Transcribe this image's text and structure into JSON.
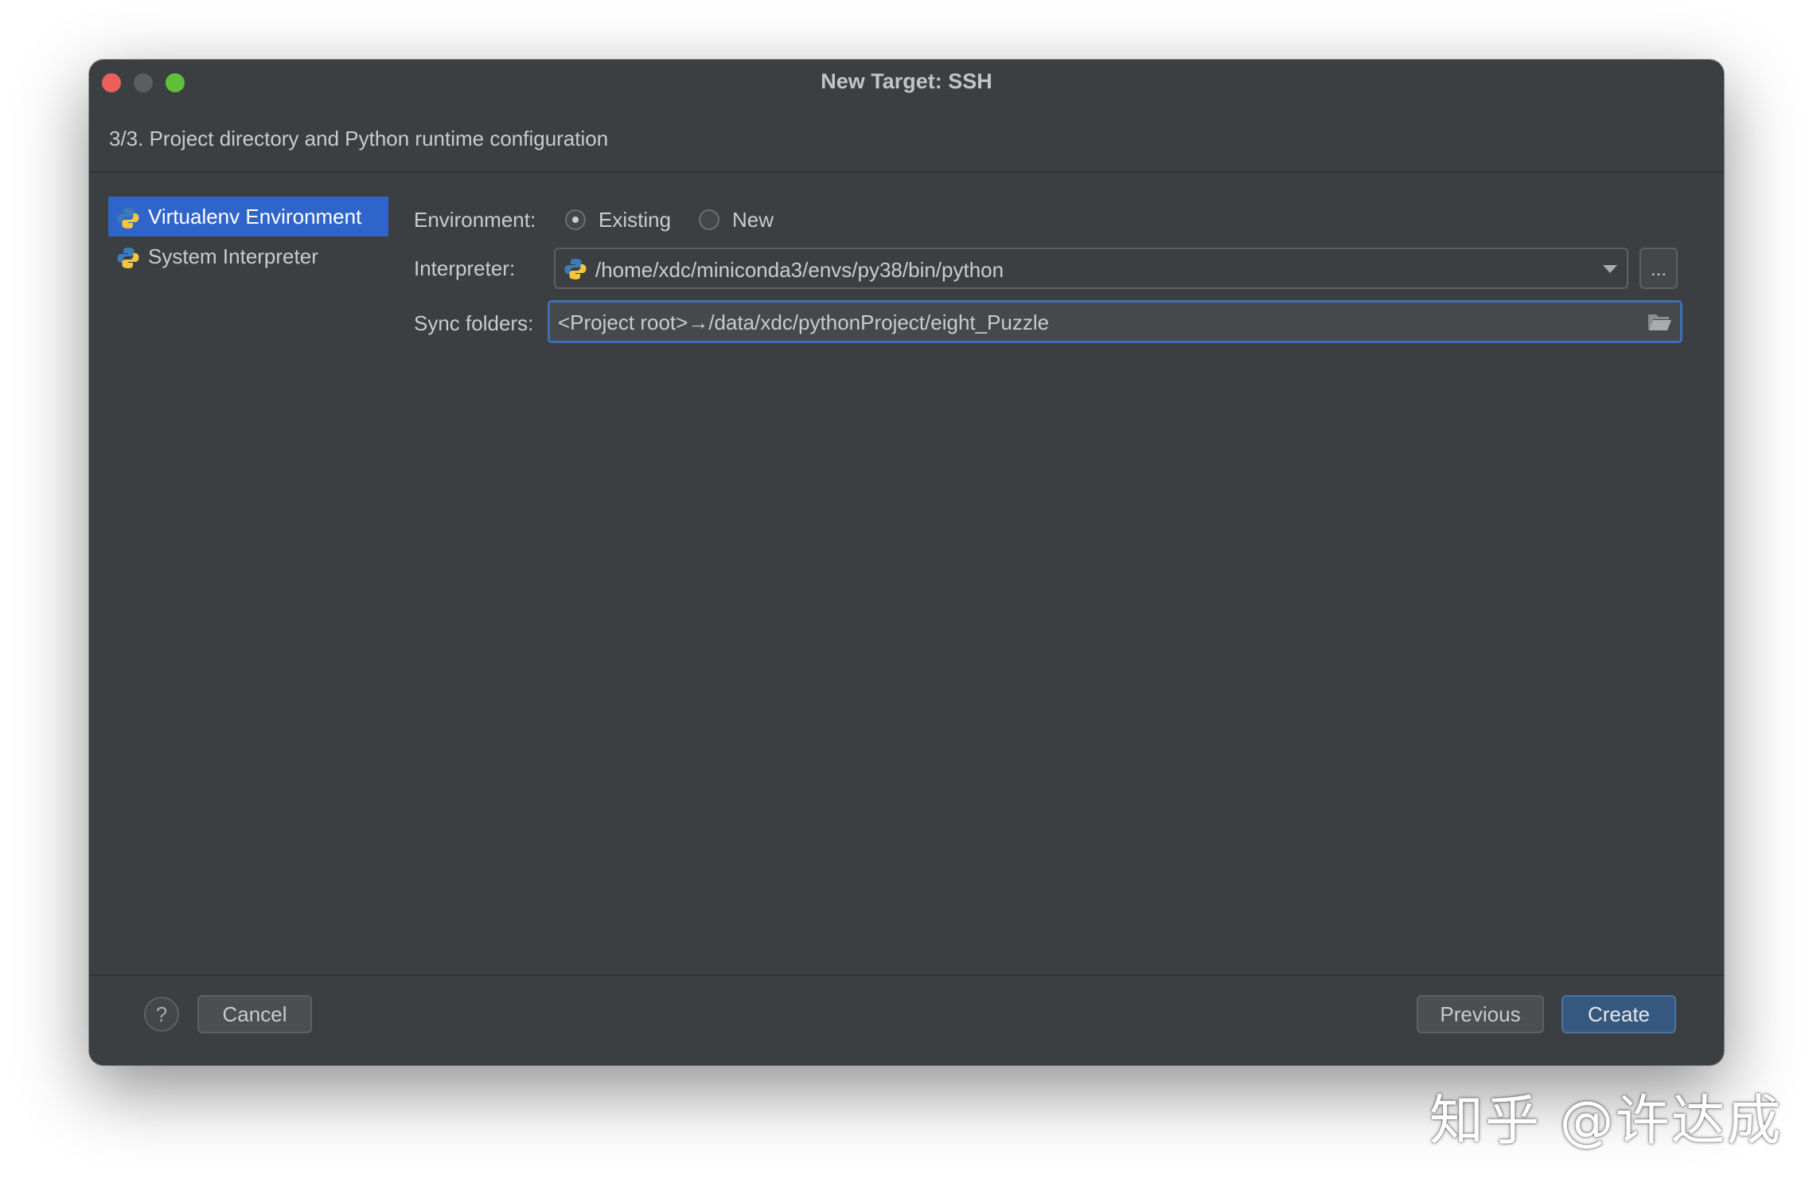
{
  "window": {
    "title": "New Target: SSH",
    "subtitle": "3/3. Project directory and Python runtime configuration"
  },
  "sidebar": {
    "items": [
      {
        "label": "Virtualenv Environment",
        "icon": "python-icon",
        "selected": true
      },
      {
        "label": "System Interpreter",
        "icon": "python-icon",
        "selected": false
      }
    ]
  },
  "form": {
    "environment": {
      "label": "Environment:",
      "options": [
        {
          "label": "Existing",
          "selected": true
        },
        {
          "label": "New",
          "selected": false
        }
      ]
    },
    "interpreter": {
      "label": "Interpreter:",
      "value": "/home/xdc/miniconda3/envs/py38/bin/python",
      "browse_label": "..."
    },
    "sync_folders": {
      "label": "Sync folders:",
      "value": "<Project root>→/data/xdc/pythonProject/eight_Puzzle"
    }
  },
  "footer": {
    "help_label": "?",
    "cancel_label": "Cancel",
    "previous_label": "Previous",
    "create_label": "Create"
  },
  "watermark": "知乎 @许达成",
  "colors": {
    "window_bg": "#3c3f41",
    "selection": "#2f65ca",
    "primary_button": "#365880",
    "focus_border": "#3d6fb4"
  }
}
